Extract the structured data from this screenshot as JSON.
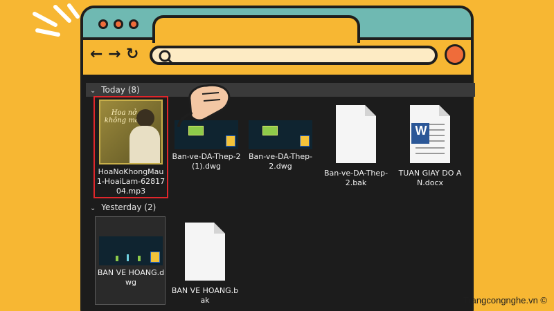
{
  "colors": {
    "background": "#f7b733",
    "frame": "#1e1e1e",
    "top_bar": "#6fb9b2",
    "accent": "#ef6c3a",
    "address_bar": "#fdebc4",
    "explorer_bg": "#1c1c1c",
    "selection": "#e0262b"
  },
  "browser": {
    "window_dots": [
      "accent-dot",
      "accent-dot",
      "accent-dot"
    ],
    "nav": {
      "back_icon": "arrow-left-icon",
      "forward_icon": "arrow-right-icon",
      "reload_icon": "reload-icon",
      "back_glyph": "←",
      "forward_glyph": "→",
      "reload_glyph": "↻"
    },
    "address_bar": {
      "value": "",
      "icon": "search-icon"
    },
    "profile_icon": "profile-circle-icon"
  },
  "explorer": {
    "groups": [
      {
        "header": "Today (8)",
        "chevron": "⌄",
        "files": [
          {
            "name": "HoaNoKhongMau1-HoaiLam-6281704.mp3",
            "type": "audio",
            "thumb_icon": "album-art-icon",
            "selected": true
          },
          {
            "name": "Ban-ve-DA-Thep-2 (1).dwg",
            "type": "dwg",
            "thumb_icon": "dwg-file-icon"
          },
          {
            "name": "Ban-ve-DA-Thep-2.dwg",
            "type": "dwg",
            "thumb_icon": "dwg-file-icon"
          },
          {
            "name": "Ban-ve-DA-Thep-2.bak",
            "type": "blank",
            "thumb_icon": "blank-file-icon"
          },
          {
            "name": "TUAN GIAY DO AN.docx",
            "type": "word",
            "thumb_icon": "word-document-icon",
            "badge": "W"
          }
        ]
      },
      {
        "header": "Yesterday (2)",
        "chevron": "⌄",
        "files": [
          {
            "name": "BAN VE HOANG.dwg",
            "type": "dwg",
            "thumb_icon": "dwg-file-icon"
          },
          {
            "name": "BAN VE HOANG.bak",
            "type": "blank",
            "thumb_icon": "blank-file-icon"
          }
        ]
      }
    ]
  },
  "album_art_text": "Hoa nở không màu",
  "pointer_icon": "pointing-hand-icon",
  "watermark": "Trangcongnghe.vn ©"
}
